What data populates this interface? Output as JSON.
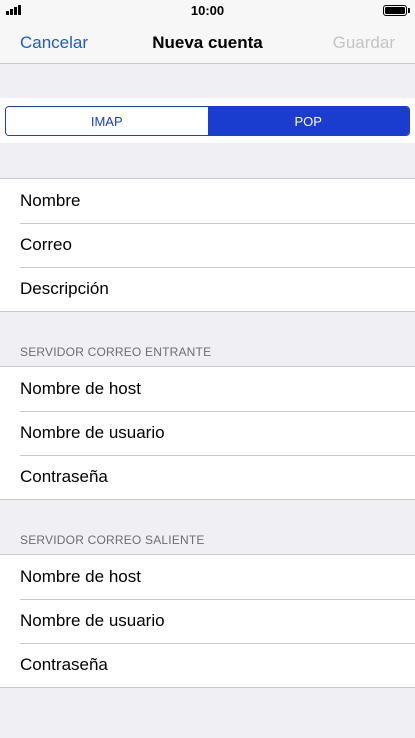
{
  "status_bar": {
    "time": "10:00"
  },
  "nav": {
    "cancel": "Cancelar",
    "title": "Nueva cuenta",
    "save": "Guardar"
  },
  "segmented": {
    "options": [
      "IMAP",
      "POP"
    ],
    "selected": "POP"
  },
  "account": {
    "rows": [
      "Nombre",
      "Correo",
      "Descripción"
    ]
  },
  "incoming": {
    "header": "SERVIDOR CORREO ENTRANTE",
    "rows": [
      "Nombre de host",
      "Nombre de usuario",
      "Contraseña"
    ]
  },
  "outgoing": {
    "header": "SERVIDOR CORREO SALIENTE",
    "rows": [
      "Nombre de host",
      "Nombre de usuario",
      "Contraseña"
    ]
  },
  "colors": {
    "accent": "#1a3ccf",
    "link": "#1a5dc9",
    "disabled": "#c4c4c6",
    "background": "#efeff4",
    "separator": "#c8c7cc"
  },
  "icons": [
    "signal-icon",
    "battery-icon"
  ]
}
